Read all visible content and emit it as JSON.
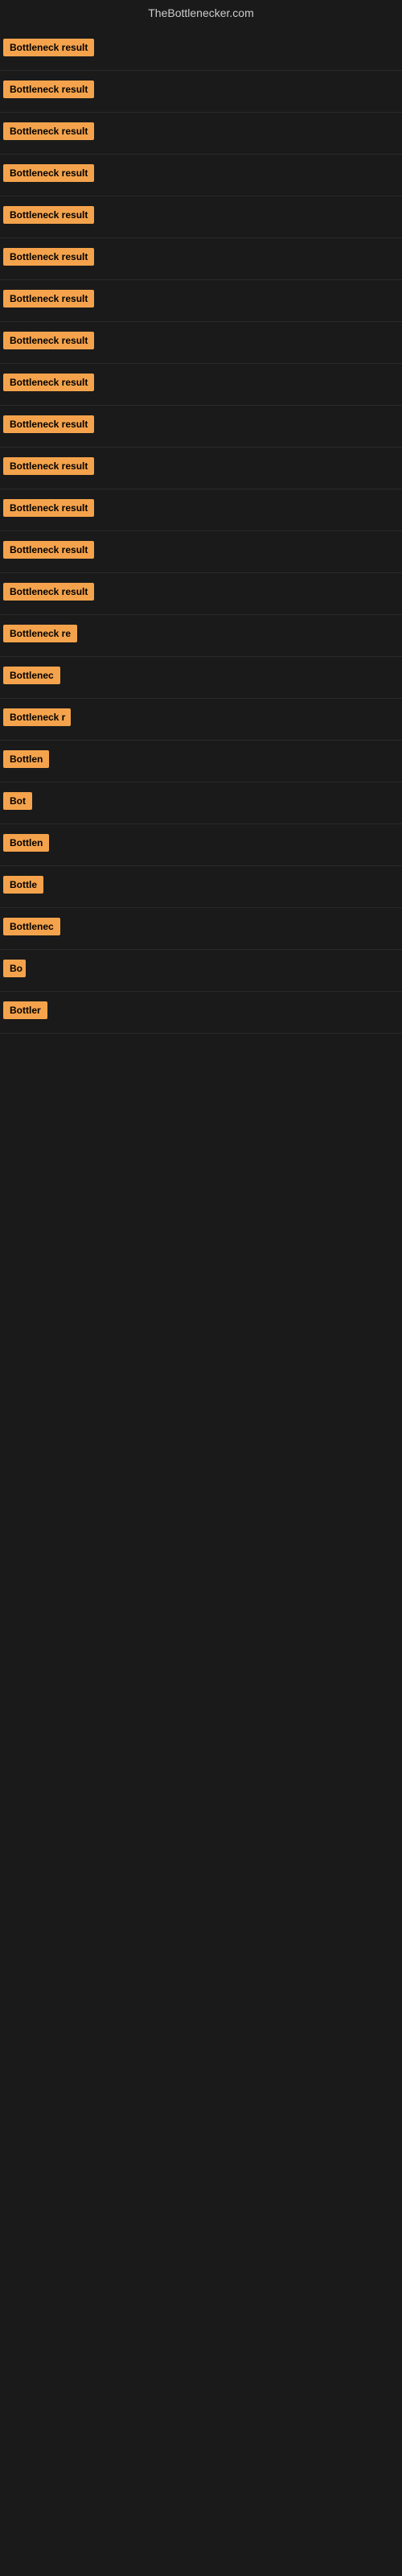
{
  "header": {
    "title": "TheBottlenecker.com"
  },
  "rows": [
    {
      "id": 1,
      "label": "Bottleneck result",
      "width": 120
    },
    {
      "id": 2,
      "label": "Bottleneck result",
      "width": 120
    },
    {
      "id": 3,
      "label": "Bottleneck result",
      "width": 120
    },
    {
      "id": 4,
      "label": "Bottleneck result",
      "width": 120
    },
    {
      "id": 5,
      "label": "Bottleneck result",
      "width": 120
    },
    {
      "id": 6,
      "label": "Bottleneck result",
      "width": 120
    },
    {
      "id": 7,
      "label": "Bottleneck result",
      "width": 120
    },
    {
      "id": 8,
      "label": "Bottleneck result",
      "width": 120
    },
    {
      "id": 9,
      "label": "Bottleneck result",
      "width": 120
    },
    {
      "id": 10,
      "label": "Bottleneck result",
      "width": 120
    },
    {
      "id": 11,
      "label": "Bottleneck result",
      "width": 120
    },
    {
      "id": 12,
      "label": "Bottleneck result",
      "width": 120
    },
    {
      "id": 13,
      "label": "Bottleneck result",
      "width": 120
    },
    {
      "id": 14,
      "label": "Bottleneck result",
      "width": 120
    },
    {
      "id": 15,
      "label": "Bottleneck re",
      "width": 96
    },
    {
      "id": 16,
      "label": "Bottlenec",
      "width": 76
    },
    {
      "id": 17,
      "label": "Bottleneck r",
      "width": 84
    },
    {
      "id": 18,
      "label": "Bottlen",
      "width": 62
    },
    {
      "id": 19,
      "label": "Bot",
      "width": 38
    },
    {
      "id": 20,
      "label": "Bottlen",
      "width": 62
    },
    {
      "id": 21,
      "label": "Bottle",
      "width": 52
    },
    {
      "id": 22,
      "label": "Bottlenec",
      "width": 74
    },
    {
      "id": 23,
      "label": "Bo",
      "width": 28
    },
    {
      "id": 24,
      "label": "Bottler",
      "width": 56
    }
  ]
}
